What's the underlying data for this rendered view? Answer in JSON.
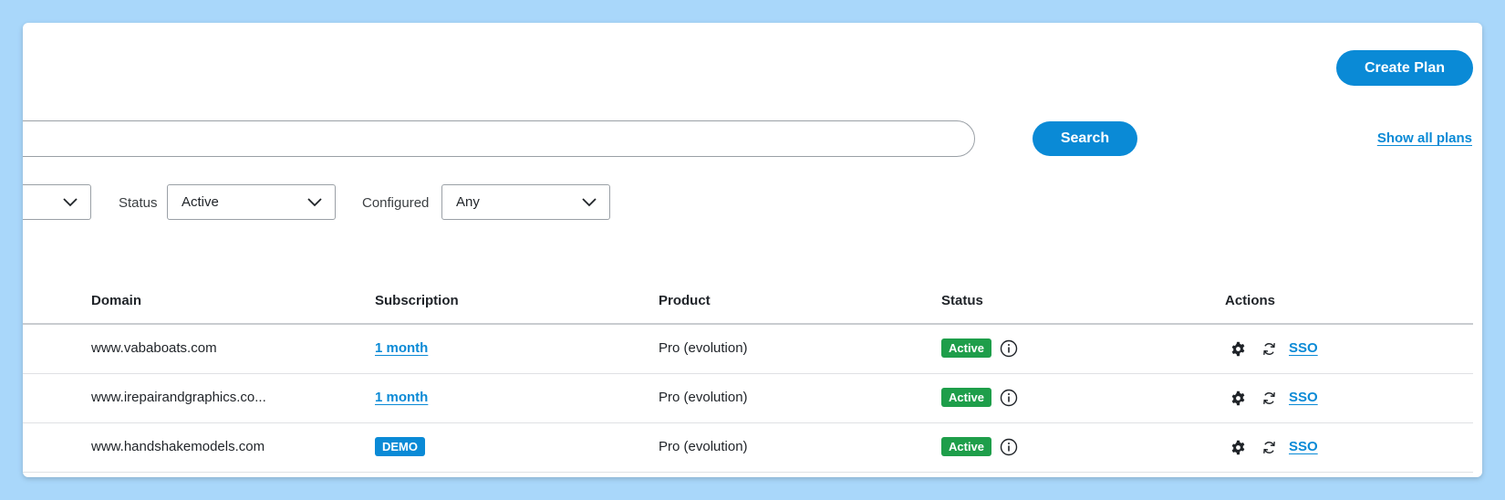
{
  "header": {
    "create_plan_label": "Create Plan"
  },
  "search": {
    "value": "",
    "placeholder": "",
    "button_label": "Search",
    "show_all_label": "Show all plans"
  },
  "filters": {
    "first": {
      "value": ""
    },
    "status": {
      "label": "Status",
      "value": "Active"
    },
    "configured": {
      "label": "Configured",
      "value": "Any"
    }
  },
  "table": {
    "headers": {
      "domain": "Domain",
      "subscription": "Subscription",
      "product": "Product",
      "status": "Status",
      "actions": "Actions"
    },
    "rows": [
      {
        "domain": "www.vababoats.com",
        "subscription": "1 month",
        "subscription_type": "link",
        "product": "Pro (evolution)",
        "status": "Active",
        "sso": "SSO"
      },
      {
        "domain": "www.irepairandgraphics.co...",
        "subscription": "1 month",
        "subscription_type": "link",
        "product": "Pro (evolution)",
        "status": "Active",
        "sso": "SSO"
      },
      {
        "domain": "www.handshakemodels.com",
        "subscription": "DEMO",
        "subscription_type": "badge",
        "product": "Pro (evolution)",
        "status": "Active",
        "sso": "SSO"
      }
    ]
  },
  "icons": {
    "select_chevron": "chevron-down-icon",
    "status_info": "info-icon",
    "settings": "gear-icon",
    "sync": "refresh-icon"
  },
  "colors": {
    "background": "#a9d7fa",
    "primary": "#0a8ad6",
    "active_badge": "#1e9e4a"
  }
}
